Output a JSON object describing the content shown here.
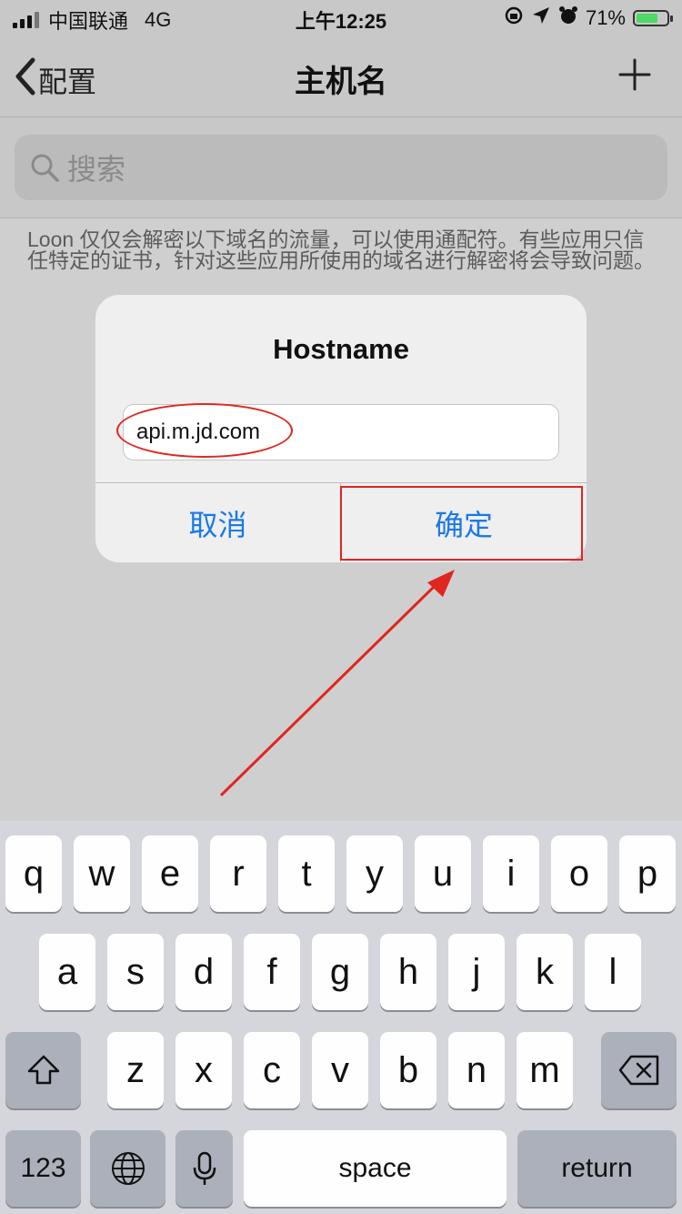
{
  "status_bar": {
    "carrier": "中国联通",
    "network": "4G",
    "time": "上午12:25",
    "battery": "71%",
    "battery_level": 0.71
  },
  "nav": {
    "back_label": "配置",
    "title": "主机名"
  },
  "search": {
    "placeholder": "搜索"
  },
  "description": "Loon 仅仅会解密以下域名的流量，可以使用通配符。有些应用只信任特定的证书，针对这些应用所使用的域名进行解密将会导致问题。",
  "dialog": {
    "title": "Hostname",
    "input_value": "api.m.jd.com",
    "cancel_label": "取消",
    "ok_label": "确定"
  },
  "keyboard": {
    "row1": [
      "q",
      "w",
      "e",
      "r",
      "t",
      "y",
      "u",
      "i",
      "o",
      "p"
    ],
    "row2": [
      "a",
      "s",
      "d",
      "f",
      "g",
      "h",
      "j",
      "k",
      "l"
    ],
    "row3": [
      "z",
      "x",
      "c",
      "v",
      "b",
      "n",
      "m"
    ],
    "numbers_label": "123",
    "space_label": "space",
    "return_label": "return"
  },
  "annotation_color": "#e0261f",
  "accent_color": "#1a7ae6"
}
